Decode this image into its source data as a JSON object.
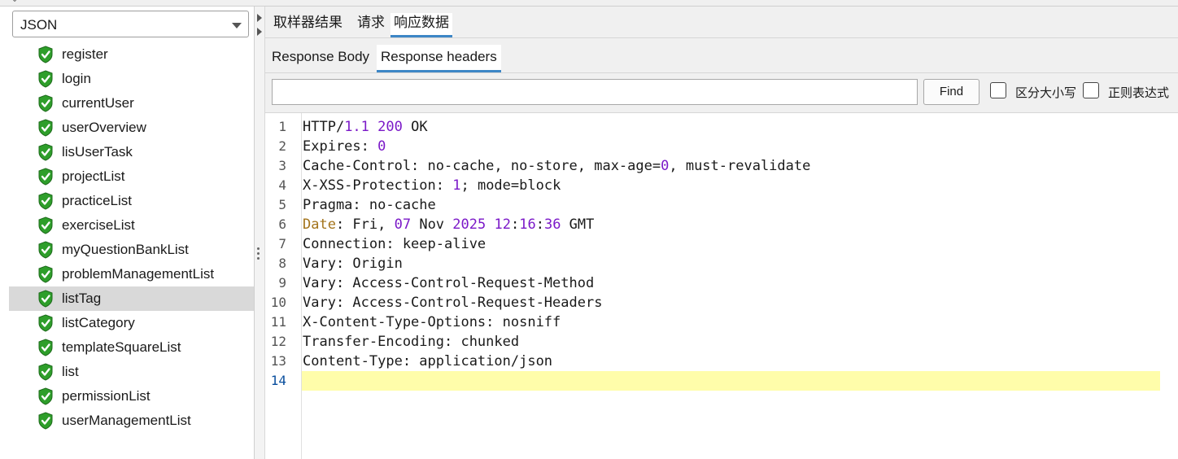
{
  "window": {
    "resize_arrows": "⇕",
    "drag_dots": "•••"
  },
  "left": {
    "select": {
      "value": "JSON"
    },
    "items": [
      {
        "label": "register",
        "selected": false
      },
      {
        "label": "login",
        "selected": false
      },
      {
        "label": "currentUser",
        "selected": false
      },
      {
        "label": "userOverview",
        "selected": false
      },
      {
        "label": "lisUserTask",
        "selected": false
      },
      {
        "label": "projectList",
        "selected": false
      },
      {
        "label": "practiceList",
        "selected": false
      },
      {
        "label": "exerciseList",
        "selected": false
      },
      {
        "label": " myQuestionBankList",
        "selected": false
      },
      {
        "label": "problemManagementList",
        "selected": false
      },
      {
        "label": "listTag",
        "selected": true
      },
      {
        "label": "listCategory",
        "selected": false
      },
      {
        "label": "templateSquareList",
        "selected": false
      },
      {
        "label": "list",
        "selected": false
      },
      {
        "label": "permissionList",
        "selected": false
      },
      {
        "label": "userManagementList",
        "selected": false
      }
    ],
    "item_icon": "green-shield-check-icon"
  },
  "tabs_top": [
    {
      "label": "取样器结果",
      "active": false
    },
    {
      "label": "请求",
      "active": false
    },
    {
      "label": "响应数据",
      "active": true
    }
  ],
  "tabs_sub": [
    {
      "label": "Response Body",
      "active": false
    },
    {
      "label": "Response headers",
      "active": true
    }
  ],
  "find": {
    "input_value": "",
    "button_label": "Find",
    "case_label": "区分大小写",
    "regex_label": "正则表达式",
    "case_checked": false,
    "regex_checked": false
  },
  "editor": {
    "current_line": 14,
    "lines": [
      {
        "n": "1",
        "segs": [
          [
            "HTTP/",
            ""
          ],
          [
            "1.1",
            "num"
          ],
          [
            " ",
            ""
          ],
          [
            "200",
            "num"
          ],
          [
            " OK",
            ""
          ]
        ]
      },
      {
        "n": "2",
        "segs": [
          [
            "Expires: ",
            ""
          ],
          [
            "0",
            "num"
          ]
        ]
      },
      {
        "n": "3",
        "segs": [
          [
            "Cache-Control: no-cache, no-store, max-age=",
            ""
          ],
          [
            "0",
            "num"
          ],
          [
            ", must-revalidate",
            ""
          ]
        ]
      },
      {
        "n": "4",
        "segs": [
          [
            "X-XSS-Protection: ",
            ""
          ],
          [
            "1",
            "num"
          ],
          [
            "; mode=block",
            ""
          ]
        ]
      },
      {
        "n": "5",
        "segs": [
          [
            "Pragma: no-cache",
            ""
          ]
        ]
      },
      {
        "n": "6",
        "segs": [
          [
            "Date",
            "kw"
          ],
          [
            ": Fri, ",
            ""
          ],
          [
            "07",
            "num"
          ],
          [
            " Nov ",
            ""
          ],
          [
            "2025",
            "num"
          ],
          [
            " ",
            ""
          ],
          [
            "12",
            "num"
          ],
          [
            ":",
            ""
          ],
          [
            "16",
            "num"
          ],
          [
            ":",
            ""
          ],
          [
            "36",
            "num"
          ],
          [
            " GMT",
            ""
          ]
        ]
      },
      {
        "n": "7",
        "segs": [
          [
            "Connection: keep-alive",
            ""
          ]
        ]
      },
      {
        "n": "8",
        "segs": [
          [
            "Vary: Origin",
            ""
          ]
        ]
      },
      {
        "n": "9",
        "segs": [
          [
            "Vary: Access-Control-Request-Method",
            ""
          ]
        ]
      },
      {
        "n": "10",
        "segs": [
          [
            "Vary: Access-Control-Request-Headers",
            ""
          ]
        ]
      },
      {
        "n": "11",
        "segs": [
          [
            "X-Content-Type-Options: nosniff",
            ""
          ]
        ]
      },
      {
        "n": "12",
        "segs": [
          [
            "Transfer-Encoding: chunked",
            ""
          ]
        ]
      },
      {
        "n": "13",
        "segs": [
          [
            "Content-Type: application/json",
            ""
          ]
        ]
      },
      {
        "n": "14",
        "segs": []
      }
    ]
  },
  "colors": {
    "accent": "#3d86c6",
    "number": "#7b19c8",
    "keyword": "#a3731a",
    "current_line_bg": "#fffdaa",
    "selected_row_bg": "#d9d9d9",
    "shield_green": "#2e9e2a"
  }
}
